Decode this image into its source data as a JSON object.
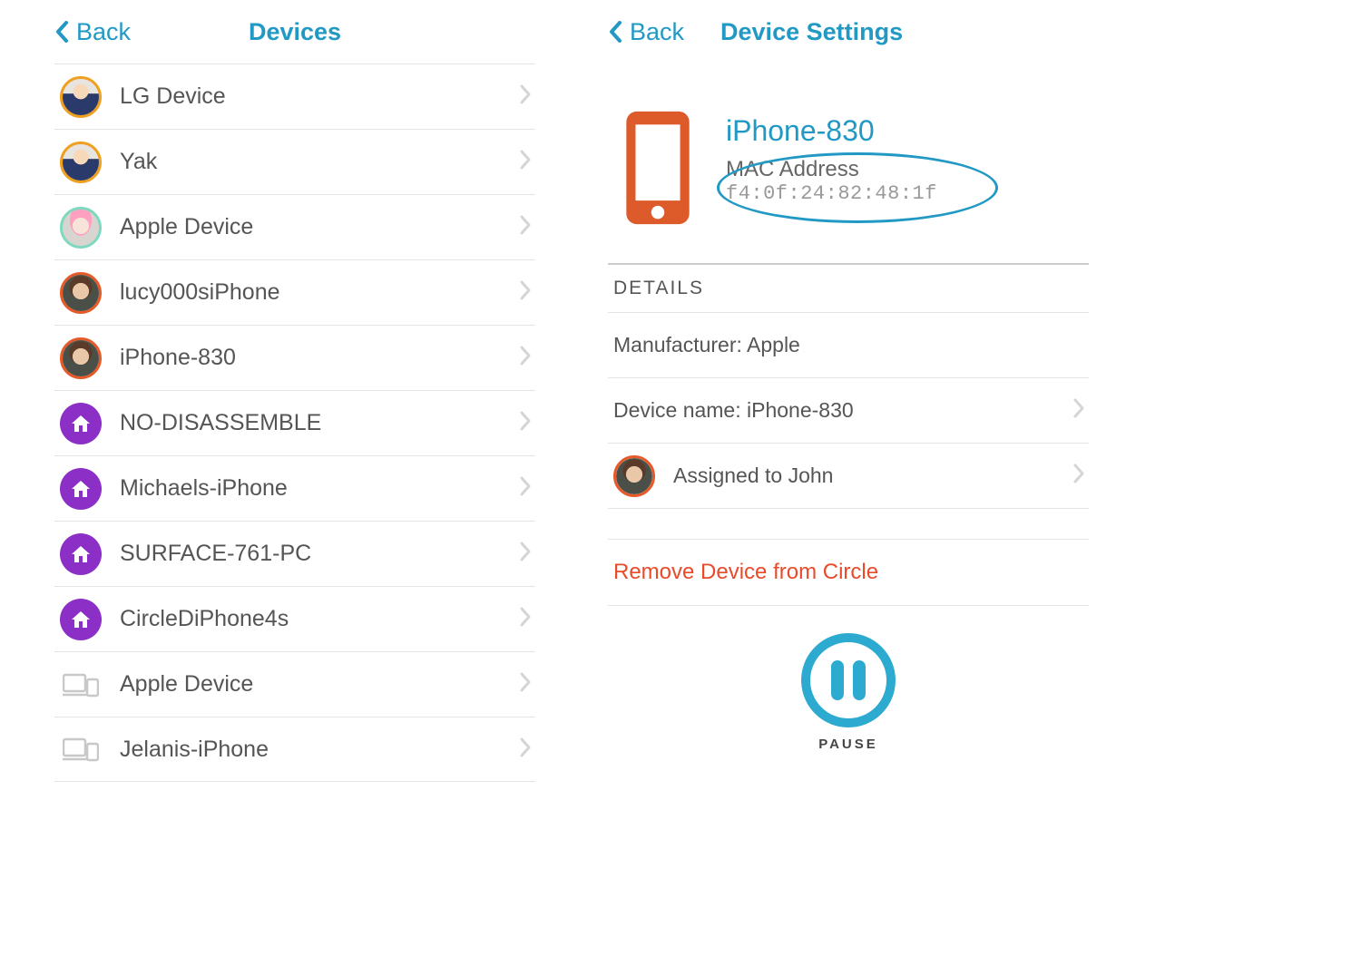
{
  "left": {
    "back_label": "Back",
    "title": "Devices",
    "items": [
      {
        "label": "LG Device",
        "iconType": "avatar",
        "ring": "gold",
        "photo": "kid"
      },
      {
        "label": "Yak",
        "iconType": "avatar",
        "ring": "gold",
        "photo": "kid"
      },
      {
        "label": "Apple Device",
        "iconType": "avatar",
        "ring": "mint",
        "photo": "face2"
      },
      {
        "label": "lucy000siPhone",
        "iconType": "avatar",
        "ring": "orange",
        "photo": "face"
      },
      {
        "label": "iPhone-830",
        "iconType": "avatar",
        "ring": "orange",
        "photo": "face"
      },
      {
        "label": "NO-DISASSEMBLE",
        "iconType": "home"
      },
      {
        "label": "Michaels-iPhone",
        "iconType": "home"
      },
      {
        "label": "SURFACE-761-PC",
        "iconType": "home"
      },
      {
        "label": "CircleDiPhone4s",
        "iconType": "home"
      },
      {
        "label": "Apple Device",
        "iconType": "devices"
      },
      {
        "label": "Jelanis-iPhone",
        "iconType": "devices"
      }
    ]
  },
  "right": {
    "back_label": "Back",
    "title": "Device Settings",
    "device_name": "iPhone-830",
    "mac_label": "MAC Address",
    "mac_value": "f4:0f:24:82:48:1f",
    "section_title": "DETAILS",
    "details": {
      "manufacturer_row": "Manufacturer: Apple",
      "device_name_row": "Device name: iPhone-830",
      "assigned_row": "Assigned to John"
    },
    "remove_label": "Remove Device from Circle",
    "pause_label": "PAUSE"
  }
}
